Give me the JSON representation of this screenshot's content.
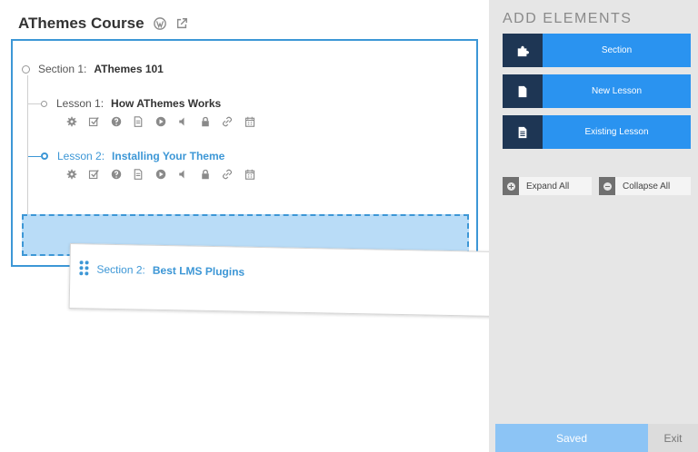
{
  "header": {
    "course_title": "AThemes Course",
    "icons": [
      "wordpress-icon",
      "external-link-icon"
    ]
  },
  "builder": {
    "section1": {
      "key": "Section 1:",
      "title": "AThemes 101"
    },
    "lessons": [
      {
        "key": "Lesson 1:",
        "title": "How AThemes Works",
        "active": false
      },
      {
        "key": "Lesson 2:",
        "title": "Installing Your Theme",
        "active": true
      }
    ],
    "lesson_tools": [
      "gear-icon",
      "checkbox-icon",
      "question-icon",
      "document-icon",
      "play-icon",
      "audio-icon",
      "lock-icon",
      "link-icon",
      "calendar-icon"
    ],
    "dragged_section": {
      "key": "Section 2:",
      "title": "Best LMS Plugins"
    }
  },
  "sidebar": {
    "title": "ADD ELEMENTS",
    "buttons": [
      {
        "label": "Section",
        "icon": "puzzle-icon"
      },
      {
        "label": "New Lesson",
        "icon": "document-icon"
      },
      {
        "label": "Existing Lesson",
        "icon": "document-lines-icon"
      }
    ],
    "expand_all": "Expand All",
    "collapse_all": "Collapse All",
    "saved": "Saved",
    "exit": "Exit"
  },
  "colors": {
    "accent": "#3d97d6",
    "button_blue": "#2a93f0",
    "icon_box": "#1e3654",
    "drop_zone": "#b9dcf7",
    "sidebar_bg": "#e6e6e6",
    "saved_btn": "#8cc4f5"
  }
}
